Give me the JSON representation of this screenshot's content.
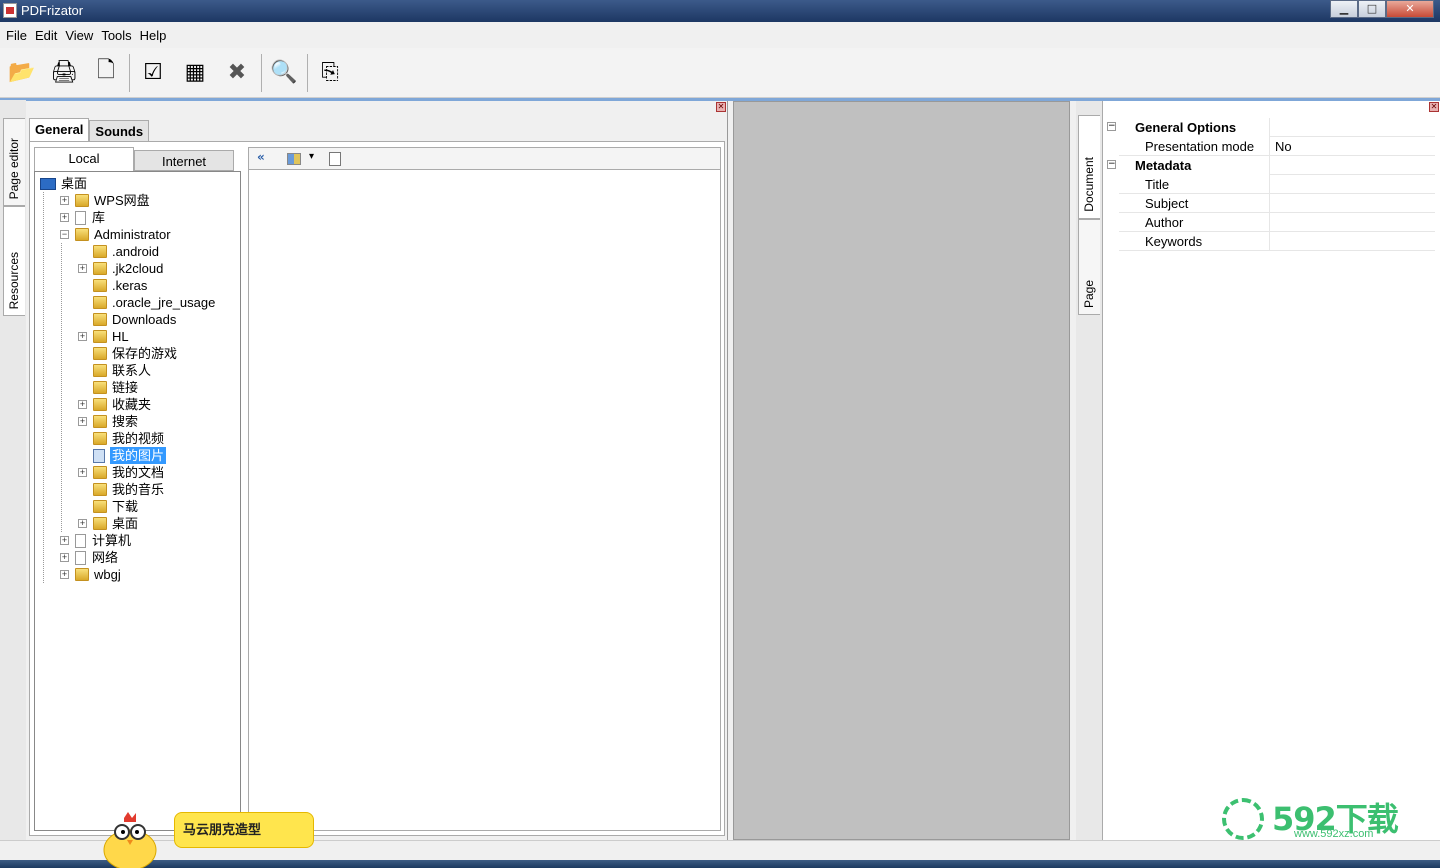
{
  "window": {
    "title": "PDFrizator",
    "min": "▁",
    "max": "□",
    "close": "✕"
  },
  "menu": [
    "File",
    "Edit",
    "View",
    "Tools",
    "Help"
  ],
  "toolbar": [
    {
      "name": "open-icon",
      "glyph": "📂"
    },
    {
      "name": "scanner-icon",
      "glyph": "🖨"
    },
    {
      "name": "new-page-icon",
      "glyph": "🗋"
    },
    {
      "name": "check-icon",
      "glyph": "☑"
    },
    {
      "name": "select-pages-icon",
      "glyph": "▦"
    },
    {
      "name": "delete-icon",
      "glyph": "✖"
    },
    {
      "name": "zoom-icon",
      "glyph": "🔍"
    },
    {
      "name": "export-icon",
      "glyph": "⎘"
    }
  ],
  "left_vtabs": [
    "Page editor",
    "Resources"
  ],
  "resource_tabs": [
    "General",
    "Sounds"
  ],
  "location_tabs": [
    "Local",
    "Internet"
  ],
  "tree": [
    {
      "label": "桌面",
      "level": 0,
      "icon": "desktop",
      "exp": ""
    },
    {
      "label": "WPS网盘",
      "level": 1,
      "icon": "folder",
      "exp": "+"
    },
    {
      "label": "库",
      "level": 1,
      "icon": "doc",
      "exp": "+"
    },
    {
      "label": "Administrator",
      "level": 1,
      "icon": "folder",
      "exp": "−"
    },
    {
      "label": ".android",
      "level": 2,
      "icon": "folder",
      "exp": ""
    },
    {
      "label": ".jk2cloud",
      "level": 2,
      "icon": "folder",
      "exp": "+"
    },
    {
      "label": ".keras",
      "level": 2,
      "icon": "folder",
      "exp": ""
    },
    {
      "label": ".oracle_jre_usage",
      "level": 2,
      "icon": "folder",
      "exp": ""
    },
    {
      "label": "Downloads",
      "level": 2,
      "icon": "folder",
      "exp": ""
    },
    {
      "label": "HL",
      "level": 2,
      "icon": "folder",
      "exp": "+"
    },
    {
      "label": "保存的游戏",
      "level": 2,
      "icon": "folder",
      "exp": ""
    },
    {
      "label": "联系人",
      "level": 2,
      "icon": "folder",
      "exp": ""
    },
    {
      "label": "链接",
      "level": 2,
      "icon": "folder",
      "exp": ""
    },
    {
      "label": "收藏夹",
      "level": 2,
      "icon": "folder",
      "exp": "+"
    },
    {
      "label": "搜索",
      "level": 2,
      "icon": "folder",
      "exp": "+"
    },
    {
      "label": "我的视频",
      "level": 2,
      "icon": "folder",
      "exp": ""
    },
    {
      "label": "我的图片",
      "level": 2,
      "icon": "image",
      "exp": "",
      "selected": true
    },
    {
      "label": "我的文档",
      "level": 2,
      "icon": "folder",
      "exp": "+"
    },
    {
      "label": "我的音乐",
      "level": 2,
      "icon": "folder",
      "exp": ""
    },
    {
      "label": "下载",
      "level": 2,
      "icon": "folder",
      "exp": ""
    },
    {
      "label": "桌面",
      "level": 2,
      "icon": "folder",
      "exp": "+"
    },
    {
      "label": "计算机",
      "level": 1,
      "icon": "doc",
      "exp": "+"
    },
    {
      "label": "网络",
      "level": 1,
      "icon": "doc",
      "exp": "+"
    },
    {
      "label": "wbgj",
      "level": 1,
      "icon": "folder",
      "exp": "+"
    }
  ],
  "filebar": {
    "back": "«",
    "view_icon": "view-options-icon",
    "dropdown": "▾",
    "doc_icon": "document-icon"
  },
  "right_vtabs": [
    "Document",
    "Page"
  ],
  "properties": {
    "general": "General Options",
    "presentation_label": "Presentation mode",
    "presentation_value": "No",
    "metadata": "Metadata",
    "title_label": "Title",
    "subject_label": "Subject",
    "author_label": "Author",
    "keywords_label": "Keywords"
  },
  "overlay": {
    "bubble_text": "马云朋克造型",
    "watermark_text": "592下载",
    "watermark_url": "www.592xz.com"
  }
}
